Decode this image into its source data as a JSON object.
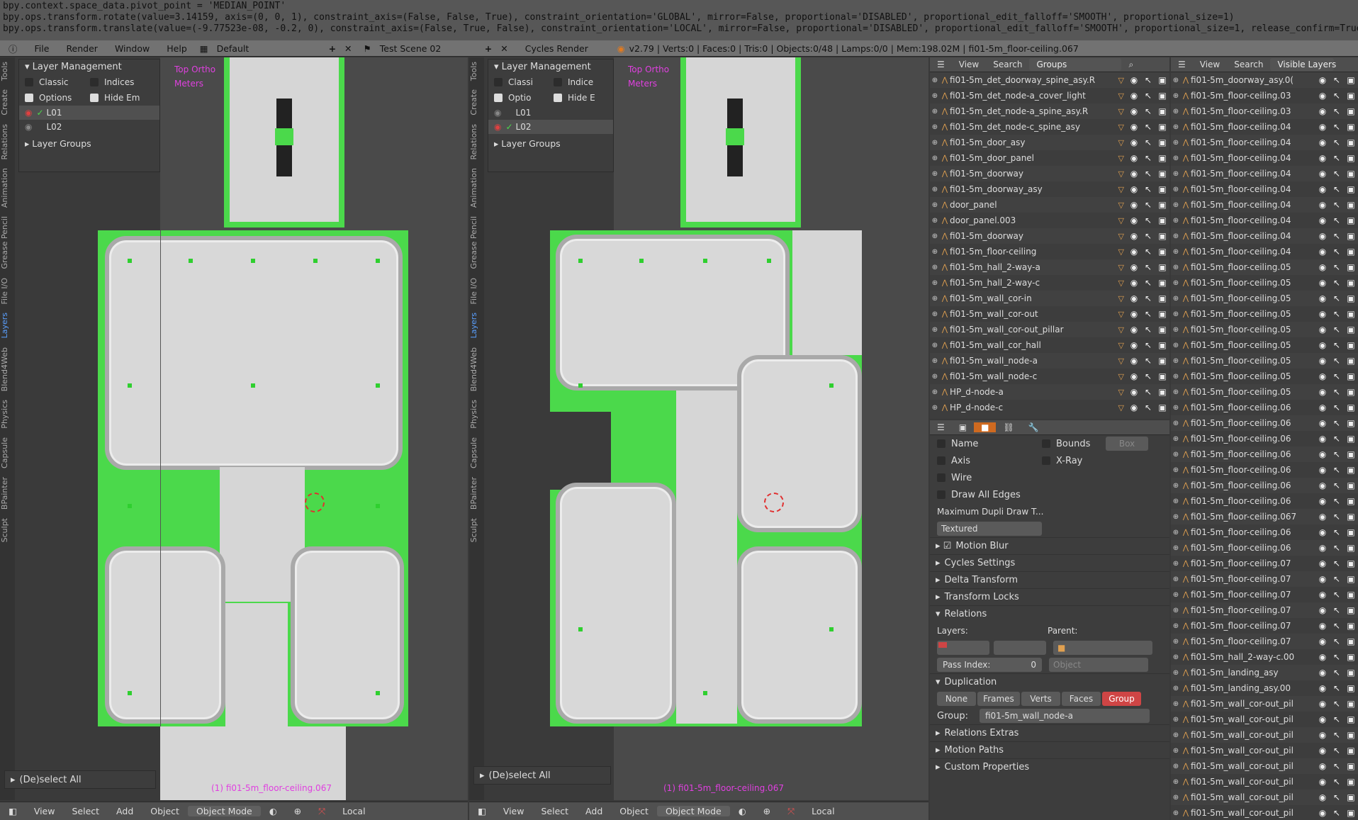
{
  "info_log": [
    "bpy.context.space_data.pivot_point = 'MEDIAN_POINT'",
    "bpy.ops.transform.rotate(value=3.14159, axis=(0, 0, 1), constraint_axis=(False, False, True), constraint_orientation='GLOBAL', mirror=False, proportional='DISABLED', proportional_edit_falloff='SMOOTH', proportional_size=1)",
    "bpy.ops.transform.translate(value=(-9.77523e-08, -0.2, 0), constraint_axis=(False, True, False), constraint_orientation='LOCAL', mirror=False, proportional='DISABLED', proportional_edit_falloff='SMOOTH', proportional_size=1, release_confirm=True, use_accurate=False)"
  ],
  "topbar": {
    "menus": [
      "File",
      "Render",
      "Window",
      "Help"
    ],
    "layout": "Default",
    "scene": "Test Scene 02",
    "engine": "Cycles Render",
    "stats": "v2.79 | Verts:0 | Faces:0 | Tris:0 | Objects:0/48 | Lamps:0/0 | Mem:198.02M | fi01-5m_floor-ceiling.067"
  },
  "tabs": [
    "Tools",
    "Create",
    "Relations",
    "Animation",
    "Grease Pencil",
    "File I/O",
    "Layers",
    "Blend4Web",
    "Physics",
    "Capsule",
    "BPainter",
    "Sculpt"
  ],
  "vp_left": {
    "panel_title": "Layer Management",
    "classic": "Classic",
    "indices": "Indices",
    "options": "Options",
    "hide_em": "Hide Em",
    "layers": [
      "L01",
      "L02"
    ],
    "layer_groups": "Layer Groups",
    "view_label": "Top Ortho",
    "units": "Meters",
    "deselect": "(De)select All",
    "object_label": "(1) fi01-5m_floor-ceiling.067"
  },
  "vp_right": {
    "panel_title": "Layer Management",
    "classic": "Classi",
    "indices": "Indice",
    "options": "Optio",
    "hide_em": "Hide E",
    "layers": [
      "L01",
      "L02"
    ],
    "layer_groups": "Layer Groups",
    "view_label": "Top Ortho",
    "units": "Meters",
    "deselect": "(De)select All",
    "object_label": "(1) fi01-5m_floor-ceiling.067"
  },
  "bottombar": {
    "items": [
      "View",
      "Select",
      "Add",
      "Object"
    ],
    "mode": "Object Mode",
    "orientation": "Local"
  },
  "outliner1": {
    "header": [
      "View",
      "Search",
      "Groups"
    ],
    "rows": [
      "fi01-5m_det_doorway_spine_asy.R",
      "fi01-5m_det_node-a_cover_light",
      "fi01-5m_det_node-a_spine_asy.R",
      "fi01-5m_det_node-c_spine_asy",
      "fi01-5m_door_asy",
      "fi01-5m_door_panel",
      "fi01-5m_doorway",
      "fi01-5m_doorway_asy",
      "door_panel",
      "door_panel.003",
      "fi01-5m_doorway",
      "fi01-5m_floor-ceiling",
      "fi01-5m_hall_2-way-a",
      "fi01-5m_hall_2-way-c",
      "fi01-5m_wall_cor-in",
      "fi01-5m_wall_cor-out",
      "fi01-5m_wall_cor-out_pillar",
      "fi01-5m_wall_cor_hall",
      "fi01-5m_wall_node-a",
      "fi01-5m_wall_node-c",
      "HP_d-node-a",
      "HP_d-node-c"
    ]
  },
  "outliner2": {
    "header": [
      "View",
      "Search",
      "Visible Layers"
    ],
    "rows": [
      "fi01-5m_doorway_asy.0(",
      "fi01-5m_floor-ceiling.03",
      "fi01-5m_floor-ceiling.03",
      "fi01-5m_floor-ceiling.04",
      "fi01-5m_floor-ceiling.04",
      "fi01-5m_floor-ceiling.04",
      "fi01-5m_floor-ceiling.04",
      "fi01-5m_floor-ceiling.04",
      "fi01-5m_floor-ceiling.04",
      "fi01-5m_floor-ceiling.04",
      "fi01-5m_floor-ceiling.04",
      "fi01-5m_floor-ceiling.04",
      "fi01-5m_floor-ceiling.05",
      "fi01-5m_floor-ceiling.05",
      "fi01-5m_floor-ceiling.05",
      "fi01-5m_floor-ceiling.05",
      "fi01-5m_floor-ceiling.05",
      "fi01-5m_floor-ceiling.05",
      "fi01-5m_floor-ceiling.05",
      "fi01-5m_floor-ceiling.05",
      "fi01-5m_floor-ceiling.05",
      "fi01-5m_floor-ceiling.06",
      "fi01-5m_floor-ceiling.06",
      "fi01-5m_floor-ceiling.06",
      "fi01-5m_floor-ceiling.06",
      "fi01-5m_floor-ceiling.06",
      "fi01-5m_floor-ceiling.06",
      "fi01-5m_floor-ceiling.06",
      "fi01-5m_floor-ceiling.067",
      "fi01-5m_floor-ceiling.06",
      "fi01-5m_floor-ceiling.06",
      "fi01-5m_floor-ceiling.07",
      "fi01-5m_floor-ceiling.07",
      "fi01-5m_floor-ceiling.07",
      "fi01-5m_floor-ceiling.07",
      "fi01-5m_floor-ceiling.07",
      "fi01-5m_floor-ceiling.07",
      "fi01-5m_hall_2-way-c.00",
      "fi01-5m_landing_asy",
      "fi01-5m_landing_asy.00",
      "fi01-5m_wall_cor-out_pil",
      "fi01-5m_wall_cor-out_pil",
      "fi01-5m_wall_cor-out_pil",
      "fi01-5m_wall_cor-out_pil",
      "fi01-5m_wall_cor-out_pil",
      "fi01-5m_wall_cor-out_pil",
      "fi01-5m_wall_cor-out_pil",
      "fi01-5m_wall_cor-out_pil"
    ]
  },
  "properties": {
    "name": "Name",
    "bounds": "Bounds",
    "box": "Box",
    "axis": "Axis",
    "xray": "X-Ray",
    "wire": "Wire",
    "draw_all_edges": "Draw All Edges",
    "max_dupli": "Maximum Dupli Draw T...",
    "textured": "Textured",
    "panels": [
      "Motion Blur",
      "Cycles Settings",
      "Delta Transform",
      "Transform Locks",
      "Relations"
    ],
    "layers_label": "Layers:",
    "parent_label": "Parent:",
    "object_placeholder": "Object",
    "pass_index": "Pass Index:",
    "pass_value": "0",
    "duplication": "Duplication",
    "dup_buttons": [
      "None",
      "Frames",
      "Verts",
      "Faces",
      "Group"
    ],
    "group_label": "Group:",
    "group_value": "fi01-5m_wall_node-a",
    "extra_panels": [
      "Relations Extras",
      "Motion Paths",
      "Custom Properties"
    ]
  }
}
